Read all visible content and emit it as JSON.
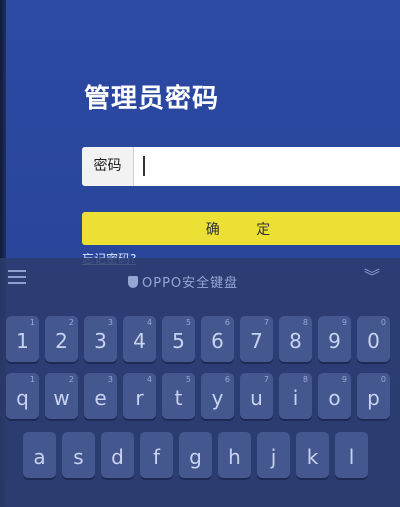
{
  "page": {
    "title": "管理员密码"
  },
  "form": {
    "password_label": "密码",
    "password_value": "",
    "confirm_label": "确 定",
    "forgot_link": "忘记密码?"
  },
  "keyboard": {
    "title": "OPPO安全键盘",
    "row_numbers": [
      {
        "key": "1",
        "hint": "1"
      },
      {
        "key": "2",
        "hint": "2"
      },
      {
        "key": "3",
        "hint": "3"
      },
      {
        "key": "4",
        "hint": "4"
      },
      {
        "key": "5",
        "hint": "5"
      },
      {
        "key": "6",
        "hint": "6"
      },
      {
        "key": "7",
        "hint": "7"
      },
      {
        "key": "8",
        "hint": "8"
      },
      {
        "key": "9",
        "hint": "9"
      },
      {
        "key": "0",
        "hint": "0"
      }
    ],
    "row_top": [
      {
        "key": "q",
        "hint": "1"
      },
      {
        "key": "w",
        "hint": "2"
      },
      {
        "key": "e",
        "hint": "3"
      },
      {
        "key": "r",
        "hint": "4"
      },
      {
        "key": "t",
        "hint": "5"
      },
      {
        "key": "y",
        "hint": "6"
      },
      {
        "key": "u",
        "hint": "7"
      },
      {
        "key": "i",
        "hint": "8"
      },
      {
        "key": "o",
        "hint": "9"
      },
      {
        "key": "p",
        "hint": "0"
      }
    ],
    "row_home": [
      {
        "key": "a",
        "hint": ""
      },
      {
        "key": "s",
        "hint": ""
      },
      {
        "key": "d",
        "hint": ""
      },
      {
        "key": "f",
        "hint": ""
      },
      {
        "key": "g",
        "hint": ""
      },
      {
        "key": "h",
        "hint": ""
      },
      {
        "key": "j",
        "hint": ""
      },
      {
        "key": "k",
        "hint": ""
      },
      {
        "key": "l",
        "hint": ""
      }
    ]
  },
  "colors": {
    "background": "#2a469c",
    "confirm_button": "#ece035"
  }
}
